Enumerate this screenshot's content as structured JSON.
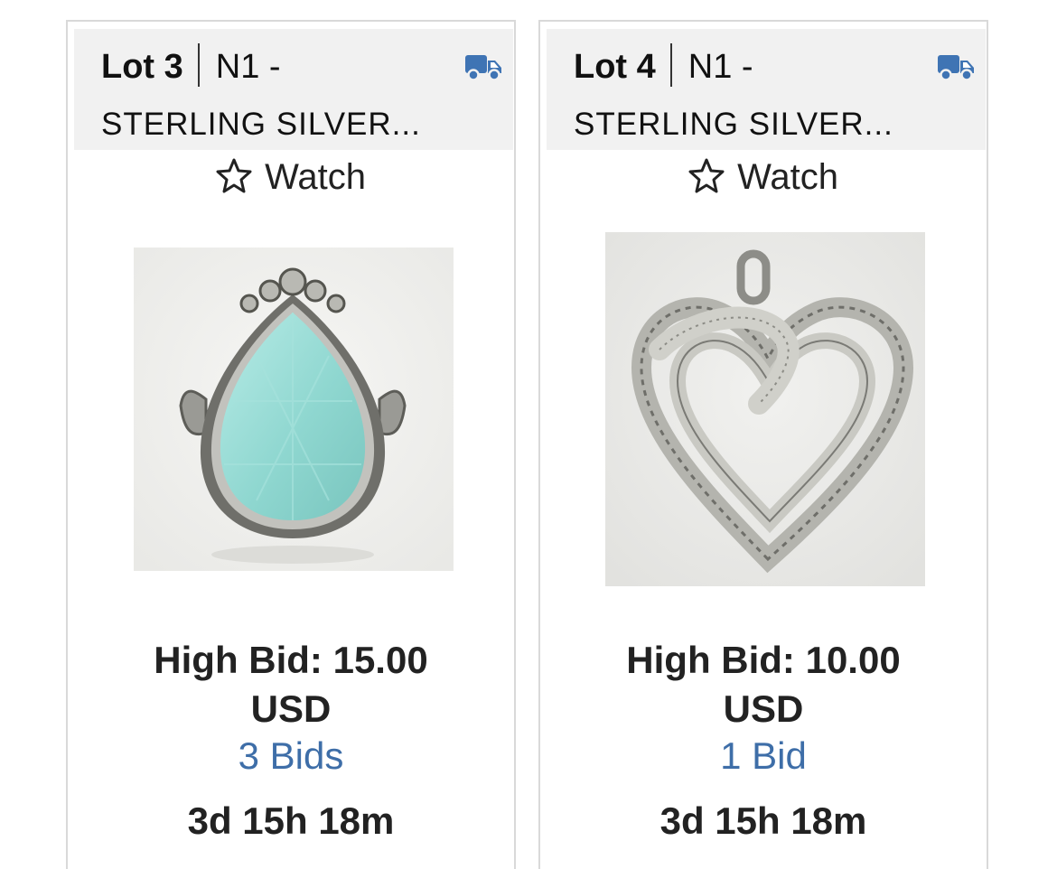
{
  "colors": {
    "link": "#3e6ea8",
    "truck": "#3f74b4",
    "header_bg": "#f1f1f1",
    "border": "#d9d9d9"
  },
  "lots": [
    {
      "lot_label": "Lot 3",
      "code": "N1 -",
      "title": "STERLING SILVER...",
      "shipping_icon": "truck-icon",
      "watch_label": "Watch",
      "watch_icon": "star-outline-icon",
      "image": "sterling-silver-ring-teardrop-aqua-stone",
      "high_bid_line1": "High Bid: 15.00",
      "high_bid_line2": "USD",
      "bids_label": "3 Bids",
      "time_left": "3d 15h 18m"
    },
    {
      "lot_label": "Lot 4",
      "code": "N1 -",
      "title": "STERLING SILVER...",
      "shipping_icon": "truck-icon",
      "watch_label": "Watch",
      "watch_icon": "star-outline-icon",
      "image": "sterling-silver-heart-pendant-diamonds",
      "high_bid_line1": "High Bid: 10.00",
      "high_bid_line2": "USD",
      "bids_label": "1 Bid",
      "time_left": "3d 15h 18m"
    }
  ]
}
